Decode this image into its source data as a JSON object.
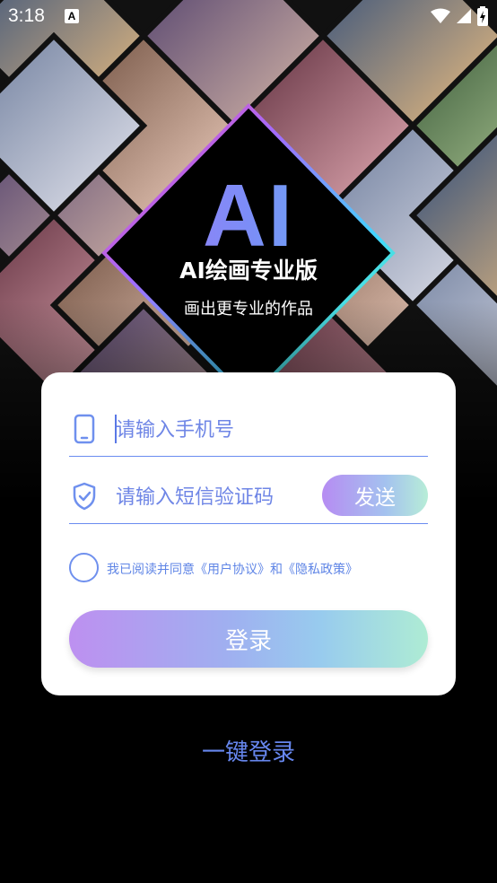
{
  "status_bar": {
    "time": "3:18",
    "left_icon": "A",
    "icons": [
      "wifi-icon",
      "signal-icon",
      "battery-icon"
    ]
  },
  "hero": {
    "logo_text": "AI",
    "title": "AI绘画专业版",
    "subtitle": "画出更专业的作品"
  },
  "form": {
    "phone_placeholder": "请输入手机号",
    "phone_icon": "phone-icon",
    "code_placeholder": "请输入短信验证码",
    "code_icon": "shield-check-icon",
    "send_label": "发送",
    "agree_text": "我已阅读并同意《用户协议》和《隐私政策》",
    "login_label": "登录"
  },
  "quick_login_label": "一键登录",
  "colors": {
    "accent": "#6a8cf0",
    "background": "#000000",
    "card": "#ffffff"
  }
}
